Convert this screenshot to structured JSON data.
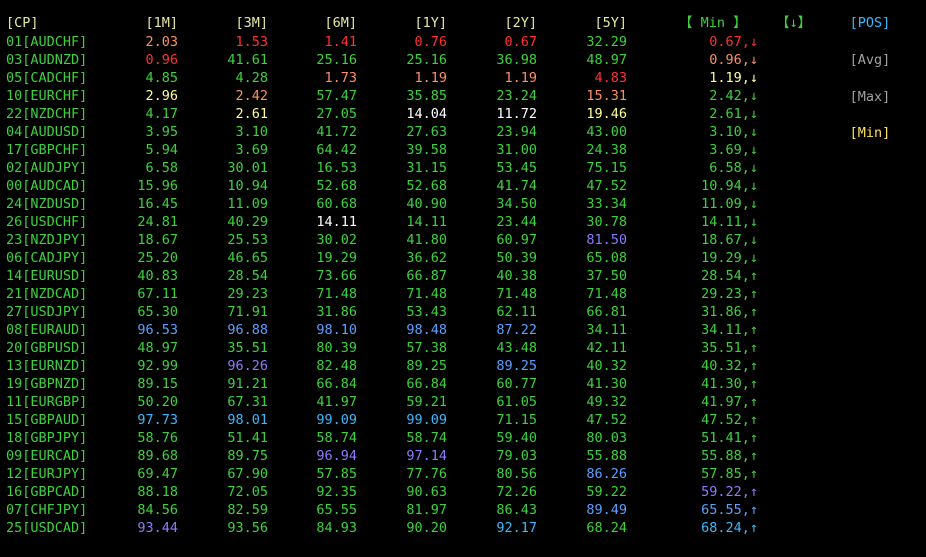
{
  "header": {
    "pair": "[CP]",
    "m1": "[1M]",
    "m3": "[3M]",
    "m6": "[6M]",
    "y1": "[1Y]",
    "y2": "[2Y]",
    "y5": "[5Y]",
    "min": "【 Min 】",
    "sort": "【↓】"
  },
  "colors": {
    "header": "#e8e8a0",
    "green": "#3dd23d",
    "red": "#ff3030",
    "orange": "#ff9060",
    "yellow": "#ffff90",
    "white": "#ffffff",
    "blue": "#5aa0ff",
    "purple": "#8a7cff",
    "cyan": "#3ab8ff",
    "gray": "#a0a0a0"
  },
  "side_buttons": [
    {
      "label": "[POS]",
      "color": "#3ab8ff"
    },
    {
      "label": "[Avg]",
      "color": "#a0a0a0"
    },
    {
      "label": "[Max]",
      "color": "#a0a0a0"
    },
    {
      "label": "[Min]",
      "color": "#ffe060"
    }
  ],
  "rows": [
    {
      "pair": "01[AUDCHF]",
      "v": [
        "2.03",
        "1.53",
        "1.41",
        "0.76",
        "0.67",
        "32.29"
      ],
      "c": [
        "orange",
        "red",
        "red",
        "red",
        "red",
        "green"
      ],
      "min": "0.67,↓",
      "mc": "red"
    },
    {
      "pair": "03[AUDNZD]",
      "v": [
        "0.96",
        "41.61",
        "25.16",
        "25.16",
        "36.98",
        "48.97"
      ],
      "c": [
        "red",
        "green",
        "green",
        "green",
        "green",
        "green"
      ],
      "min": "0.96,↓",
      "mc": "orange"
    },
    {
      "pair": "05[CADCHF]",
      "v": [
        "4.85",
        "4.28",
        "1.73",
        "1.19",
        "1.19",
        "4.83"
      ],
      "c": [
        "green",
        "green",
        "orange",
        "orange",
        "orange",
        "red"
      ],
      "min": "1.19,↓",
      "mc": "yellow"
    },
    {
      "pair": "10[EURCHF]",
      "v": [
        "2.96",
        "2.42",
        "57.47",
        "35.85",
        "23.24",
        "15.31"
      ],
      "c": [
        "yellow",
        "orange",
        "green",
        "green",
        "green",
        "orange"
      ],
      "min": "2.42,↓",
      "mc": "green"
    },
    {
      "pair": "22[NZDCHF]",
      "v": [
        "4.17",
        "2.61",
        "27.05",
        "14.04",
        "11.72",
        "19.46"
      ],
      "c": [
        "green",
        "yellow",
        "green",
        "white",
        "white",
        "yellow"
      ],
      "min": "2.61,↓",
      "mc": "green"
    },
    {
      "pair": "04[AUDUSD]",
      "v": [
        "3.95",
        "3.10",
        "41.72",
        "27.63",
        "23.94",
        "43.00"
      ],
      "c": [
        "green",
        "green",
        "green",
        "green",
        "green",
        "green"
      ],
      "min": "3.10,↓",
      "mc": "green"
    },
    {
      "pair": "17[GBPCHF]",
      "v": [
        "5.94",
        "3.69",
        "64.42",
        "39.58",
        "31.00",
        "24.38"
      ],
      "c": [
        "green",
        "green",
        "green",
        "green",
        "green",
        "green"
      ],
      "min": "3.69,↓",
      "mc": "green"
    },
    {
      "pair": "02[AUDJPY]",
      "v": [
        "6.58",
        "30.01",
        "16.53",
        "31.15",
        "53.45",
        "75.15"
      ],
      "c": [
        "green",
        "green",
        "green",
        "green",
        "green",
        "green"
      ],
      "min": "6.58,↓",
      "mc": "green"
    },
    {
      "pair": "00[AUDCAD]",
      "v": [
        "15.96",
        "10.94",
        "52.68",
        "52.68",
        "41.74",
        "47.52"
      ],
      "c": [
        "green",
        "green",
        "green",
        "green",
        "green",
        "green"
      ],
      "min": "10.94,↓",
      "mc": "green"
    },
    {
      "pair": "24[NZDUSD]",
      "v": [
        "16.45",
        "11.09",
        "60.68",
        "40.90",
        "34.50",
        "33.34"
      ],
      "c": [
        "green",
        "green",
        "green",
        "green",
        "green",
        "green"
      ],
      "min": "11.09,↓",
      "mc": "green"
    },
    {
      "pair": "26[USDCHF]",
      "v": [
        "24.81",
        "40.29",
        "14.11",
        "14.11",
        "23.44",
        "30.78"
      ],
      "c": [
        "green",
        "green",
        "white",
        "green",
        "green",
        "green"
      ],
      "min": "14.11,↓",
      "mc": "green"
    },
    {
      "pair": "23[NZDJPY]",
      "v": [
        "18.67",
        "25.53",
        "30.02",
        "41.80",
        "60.97",
        "81.50"
      ],
      "c": [
        "green",
        "green",
        "green",
        "green",
        "green",
        "purple"
      ],
      "min": "18.67,↓",
      "mc": "green"
    },
    {
      "pair": "06[CADJPY]",
      "v": [
        "25.20",
        "46.65",
        "19.29",
        "36.62",
        "50.39",
        "65.08"
      ],
      "c": [
        "green",
        "green",
        "green",
        "green",
        "green",
        "green"
      ],
      "min": "19.29,↓",
      "mc": "green"
    },
    {
      "pair": "14[EURUSD]",
      "v": [
        "40.83",
        "28.54",
        "73.66",
        "66.87",
        "40.38",
        "37.50"
      ],
      "c": [
        "green",
        "green",
        "green",
        "green",
        "green",
        "green"
      ],
      "min": "28.54,↑",
      "mc": "green"
    },
    {
      "pair": "21[NZDCAD]",
      "v": [
        "67.11",
        "29.23",
        "71.48",
        "71.48",
        "71.48",
        "71.48"
      ],
      "c": [
        "green",
        "green",
        "green",
        "green",
        "green",
        "green"
      ],
      "min": "29.23,↑",
      "mc": "green"
    },
    {
      "pair": "27[USDJPY]",
      "v": [
        "65.30",
        "71.91",
        "31.86",
        "53.43",
        "62.11",
        "66.81"
      ],
      "c": [
        "green",
        "green",
        "green",
        "green",
        "green",
        "green"
      ],
      "min": "31.86,↑",
      "mc": "green"
    },
    {
      "pair": "08[EURAUD]",
      "v": [
        "96.53",
        "96.88",
        "98.10",
        "98.48",
        "87.22",
        "34.11"
      ],
      "c": [
        "blue",
        "blue",
        "blue",
        "blue",
        "blue",
        "green"
      ],
      "min": "34.11,↑",
      "mc": "green"
    },
    {
      "pair": "20[GBPUSD]",
      "v": [
        "48.97",
        "35.51",
        "80.39",
        "57.38",
        "43.48",
        "42.11"
      ],
      "c": [
        "green",
        "green",
        "green",
        "green",
        "green",
        "green"
      ],
      "min": "35.51,↑",
      "mc": "green"
    },
    {
      "pair": "13[EURNZD]",
      "v": [
        "92.99",
        "96.26",
        "82.48",
        "89.25",
        "89.25",
        "40.32"
      ],
      "c": [
        "green",
        "purple",
        "green",
        "green",
        "blue",
        "green"
      ],
      "min": "40.32,↑",
      "mc": "green"
    },
    {
      "pair": "19[GBPNZD]",
      "v": [
        "89.15",
        "91.21",
        "66.84",
        "66.84",
        "60.77",
        "41.30"
      ],
      "c": [
        "green",
        "green",
        "green",
        "green",
        "green",
        "green"
      ],
      "min": "41.30,↑",
      "mc": "green"
    },
    {
      "pair": "11[EURGBP]",
      "v": [
        "50.20",
        "67.31",
        "41.97",
        "59.21",
        "61.05",
        "49.32"
      ],
      "c": [
        "green",
        "green",
        "green",
        "green",
        "green",
        "green"
      ],
      "min": "41.97,↑",
      "mc": "green"
    },
    {
      "pair": "15[GBPAUD]",
      "v": [
        "97.73",
        "98.01",
        "99.09",
        "99.09",
        "71.15",
        "47.52"
      ],
      "c": [
        "cyan",
        "cyan",
        "cyan",
        "cyan",
        "green",
        "green"
      ],
      "min": "47.52,↑",
      "mc": "green"
    },
    {
      "pair": "18[GBPJPY]",
      "v": [
        "58.76",
        "51.41",
        "58.74",
        "58.74",
        "59.40",
        "80.03"
      ],
      "c": [
        "green",
        "green",
        "green",
        "green",
        "green",
        "green"
      ],
      "min": "51.41,↑",
      "mc": "green"
    },
    {
      "pair": "09[EURCAD]",
      "v": [
        "89.68",
        "89.75",
        "96.94",
        "97.14",
        "79.03",
        "55.88"
      ],
      "c": [
        "green",
        "green",
        "purple",
        "purple",
        "green",
        "green"
      ],
      "min": "55.88,↑",
      "mc": "green"
    },
    {
      "pair": "12[EURJPY]",
      "v": [
        "69.47",
        "67.90",
        "57.85",
        "77.76",
        "80.56",
        "86.26"
      ],
      "c": [
        "green",
        "green",
        "green",
        "green",
        "green",
        "blue"
      ],
      "min": "57.85,↑",
      "mc": "green"
    },
    {
      "pair": "16[GBPCAD]",
      "v": [
        "88.18",
        "72.05",
        "92.35",
        "90.63",
        "72.26",
        "59.22"
      ],
      "c": [
        "green",
        "green",
        "green",
        "green",
        "green",
        "green"
      ],
      "min": "59.22,↑",
      "mc": "purple"
    },
    {
      "pair": "07[CHFJPY]",
      "v": [
        "84.56",
        "82.59",
        "65.55",
        "81.97",
        "86.43",
        "89.49"
      ],
      "c": [
        "green",
        "green",
        "green",
        "green",
        "green",
        "blue"
      ],
      "min": "65.55,↑",
      "mc": "blue"
    },
    {
      "pair": "25[USDCAD]",
      "v": [
        "93.44",
        "93.56",
        "84.93",
        "90.20",
        "92.17",
        "68.24"
      ],
      "c": [
        "purple",
        "green",
        "green",
        "green",
        "cyan",
        "green"
      ],
      "min": "68.24,↑",
      "mc": "cyan"
    }
  ]
}
